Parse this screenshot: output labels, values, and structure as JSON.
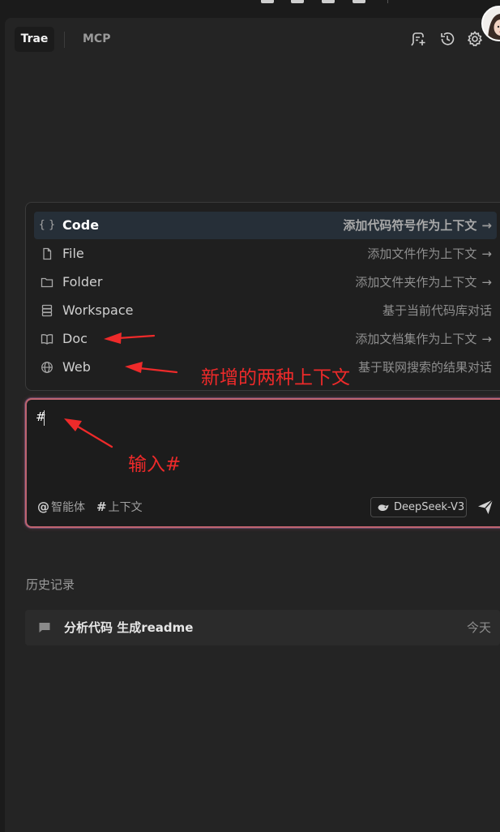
{
  "header": {
    "tabs": [
      {
        "label": "Trae",
        "active": true
      },
      {
        "label": "MCP",
        "active": false
      }
    ],
    "icons": [
      "new-chat-icon",
      "history-icon",
      "settings-icon"
    ]
  },
  "context_menu": {
    "items": [
      {
        "icon": "braces-icon",
        "glyph": "{ }",
        "label": "Code",
        "description": "添加代码符号作为上下文",
        "has_arrow": true,
        "active": true
      },
      {
        "icon": "file-icon",
        "label": "File",
        "description": "添加文件作为上下文",
        "has_arrow": true,
        "active": false
      },
      {
        "icon": "folder-icon",
        "label": "Folder",
        "description": "添加文件夹作为上下文",
        "has_arrow": true,
        "active": false
      },
      {
        "icon": "workspace-icon",
        "label": "Workspace",
        "description": "基于当前代码库对话",
        "has_arrow": false,
        "active": false
      },
      {
        "icon": "book-icon",
        "label": "Doc",
        "description": "添加文档集作为上下文",
        "has_arrow": true,
        "active": false
      },
      {
        "icon": "globe-icon",
        "label": "Web",
        "description": "基于联网搜索的结果对话",
        "has_arrow": false,
        "active": false
      }
    ],
    "arrow_glyph": "→"
  },
  "input": {
    "value": "#",
    "agent_chip": {
      "symbol": "@",
      "label": "智能体"
    },
    "context_chip": {
      "symbol": "#",
      "label": "上下文"
    },
    "model": "DeepSeek-V3",
    "border_color": "#c06470"
  },
  "history": {
    "title": "历史记录",
    "items": [
      {
        "title": "分析代码 生成readme",
        "date": "今天"
      }
    ]
  },
  "annotations": {
    "new_contexts": "新增的两种上下文",
    "type_hash": "输入#",
    "color": "#ee2a2a"
  }
}
